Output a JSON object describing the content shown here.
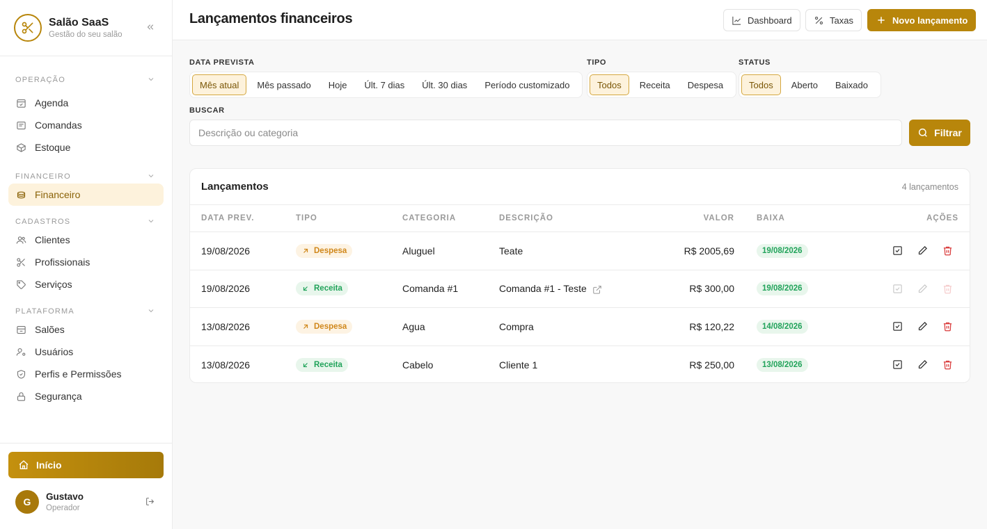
{
  "brand": {
    "title": "Salão SaaS",
    "subtitle": "Gestão do seu salão"
  },
  "sidebar": {
    "sections": [
      {
        "title": "OPERAÇÃO",
        "items": [
          {
            "label": "Agenda",
            "icon": "calendar-check-icon"
          },
          {
            "label": "Comandas",
            "icon": "receipt-icon"
          },
          {
            "label": "Estoque",
            "icon": "box-icon"
          }
        ]
      },
      {
        "title": "FINANCEIRO",
        "items": [
          {
            "label": "Financeiro",
            "icon": "coins-icon",
            "active": true
          }
        ]
      },
      {
        "title": "CADASTROS",
        "items": [
          {
            "label": "Clientes",
            "icon": "users-icon"
          },
          {
            "label": "Profissionais",
            "icon": "scissors-icon"
          },
          {
            "label": "Serviços",
            "icon": "tag-icon"
          }
        ]
      },
      {
        "title": "PLATAFORMA",
        "items": [
          {
            "label": "Salões",
            "icon": "store-icon"
          },
          {
            "label": "Usuários",
            "icon": "user-cog-icon"
          },
          {
            "label": "Perfis e Permissões",
            "icon": "shield-check-icon"
          },
          {
            "label": "Segurança",
            "icon": "lock-icon"
          }
        ]
      }
    ],
    "home_label": "Início",
    "user": {
      "initial": "G",
      "name": "Gustavo",
      "role": "Operador"
    }
  },
  "header": {
    "title": "Lançamentos financeiros",
    "dashboard_label": "Dashboard",
    "taxas_label": "Taxas",
    "new_label": "Novo lançamento"
  },
  "filters": {
    "period_label": "DATA PREVISTA",
    "period_options": [
      "Mês atual",
      "Mês passado",
      "Hoje",
      "Últ. 7 dias",
      "Últ. 30 dias",
      "Período customizado"
    ],
    "period_selected": "Mês atual",
    "type_label": "TIPO",
    "type_options": [
      "Todos",
      "Receita",
      "Despesa"
    ],
    "type_selected": "Todos",
    "status_label": "STATUS",
    "status_options": [
      "Todos",
      "Aberto",
      "Baixado"
    ],
    "status_selected": "Todos",
    "search_label": "BUSCAR",
    "search_placeholder": "Descrição ou categoria",
    "search_value": "",
    "filter_button": "Filtrar"
  },
  "table": {
    "title": "Lançamentos",
    "count": "4 lançamentos",
    "columns": [
      "DATA PREV.",
      "TIPO",
      "CATEGORIA",
      "DESCRIÇÃO",
      "VALOR",
      "BAIXA",
      "AÇÕES"
    ],
    "rows": [
      {
        "date": "19/08/2026",
        "type": "Despesa",
        "category": "Aluguel",
        "description": "Teate",
        "value": "R$ 2005,69",
        "settled": "19/08/2026",
        "external": false,
        "actions_disabled": false
      },
      {
        "date": "19/08/2026",
        "type": "Receita",
        "category": "Comanda #1",
        "description": "Comanda #1 - Teste",
        "value": "R$ 300,00",
        "settled": "19/08/2026",
        "external": true,
        "actions_disabled": true
      },
      {
        "date": "13/08/2026",
        "type": "Despesa",
        "category": "Agua",
        "description": "Compra",
        "value": "R$ 120,22",
        "settled": "14/08/2026",
        "external": false,
        "actions_disabled": false
      },
      {
        "date": "13/08/2026",
        "type": "Receita",
        "category": "Cabelo",
        "description": "Cliente 1",
        "value": "R$ 250,00",
        "settled": "13/08/2026",
        "external": false,
        "actions_disabled": false
      }
    ]
  },
  "colors": {
    "accent": "#b8860b",
    "despesa": "#d0871a",
    "receita": "#21a35a",
    "delete": "#d93a3a"
  }
}
